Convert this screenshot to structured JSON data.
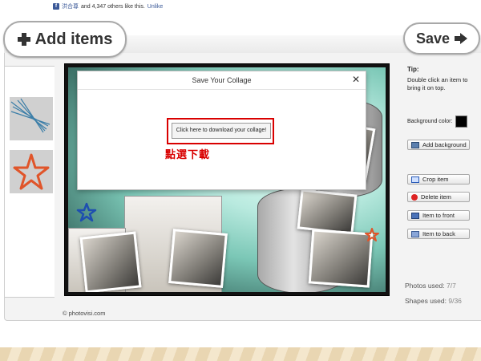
{
  "like_bar": {
    "name": "洪合尊",
    "text": "and 4,347 others like this.",
    "unlike": "Unlike"
  },
  "toolbar": {
    "add_items_label": "Add items",
    "save_label": "Save"
  },
  "dialog": {
    "title": "Save Your Collage",
    "close": "✕",
    "download_button": "Click here to download your collage!",
    "annotation": "點選下載"
  },
  "sidebar": {
    "tip_title": "Tip:",
    "tip_text": "Double click an item to bring it on top.",
    "background_color_label": "Background color:",
    "background_color": "#000000",
    "buttons": {
      "add_background": "Add background",
      "crop_item": "Crop item",
      "delete_item": "Delete item",
      "item_to_front": "Item to front",
      "item_to_back": "Item to back"
    },
    "photos_used_label": "Photos used:",
    "photos_used_value": "7/7",
    "shapes_used_label": "Shapes used:",
    "shapes_used_value": "9/36"
  },
  "footer": {
    "copyright": "© photovisi.com"
  },
  "colors": {
    "accent_red": "#d90000",
    "facebook_blue": "#3b5998"
  }
}
